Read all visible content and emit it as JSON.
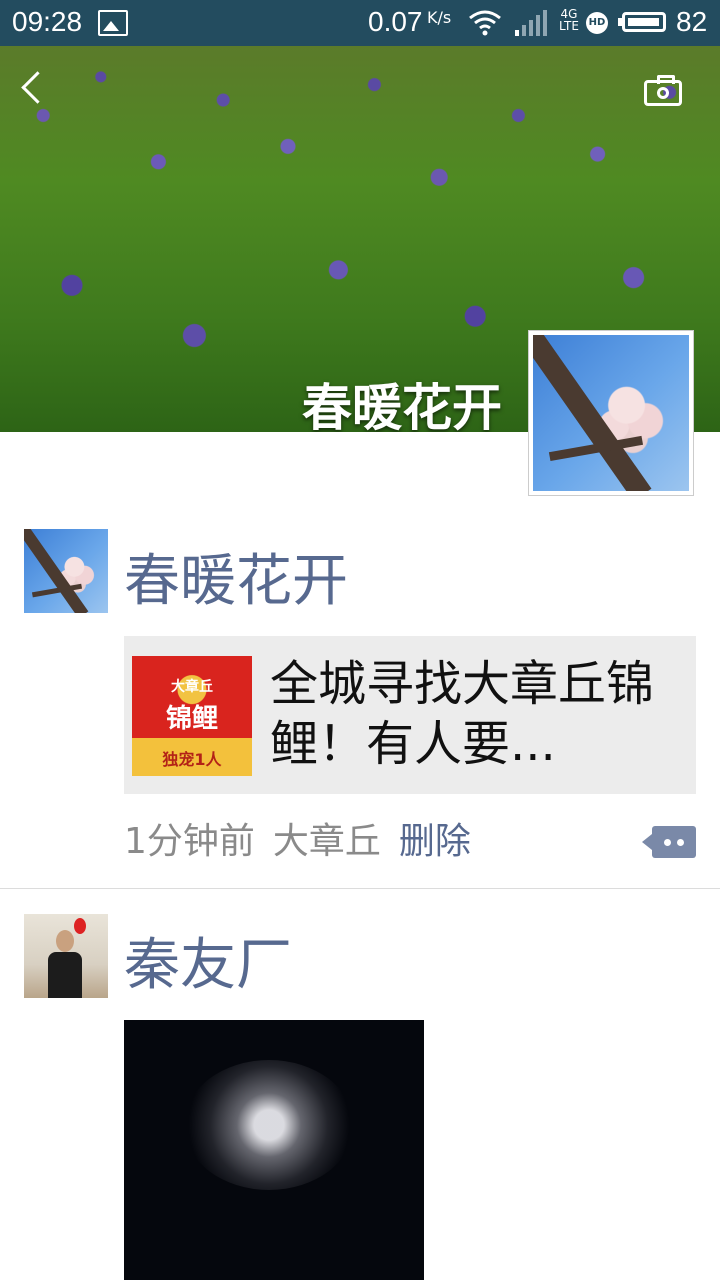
{
  "status_bar": {
    "time": "09:28",
    "net_speed": "0.07",
    "net_speed_unit": "K/s",
    "network_type": "4G",
    "network_sub": "LTE",
    "hd": "HD",
    "battery": "82"
  },
  "cover": {
    "name": "春暖花开"
  },
  "posts": [
    {
      "username": "春暖花开",
      "share": {
        "thumb_line1": "大章丘",
        "thumb_line2": "锦鲤",
        "thumb_line3": "独宠1人",
        "title": "全城寻找大章丘锦鲤！有人要..."
      },
      "time": "1分钟前",
      "location": "大章丘",
      "delete_label": "删除"
    },
    {
      "username": "秦友厂"
    }
  ]
}
